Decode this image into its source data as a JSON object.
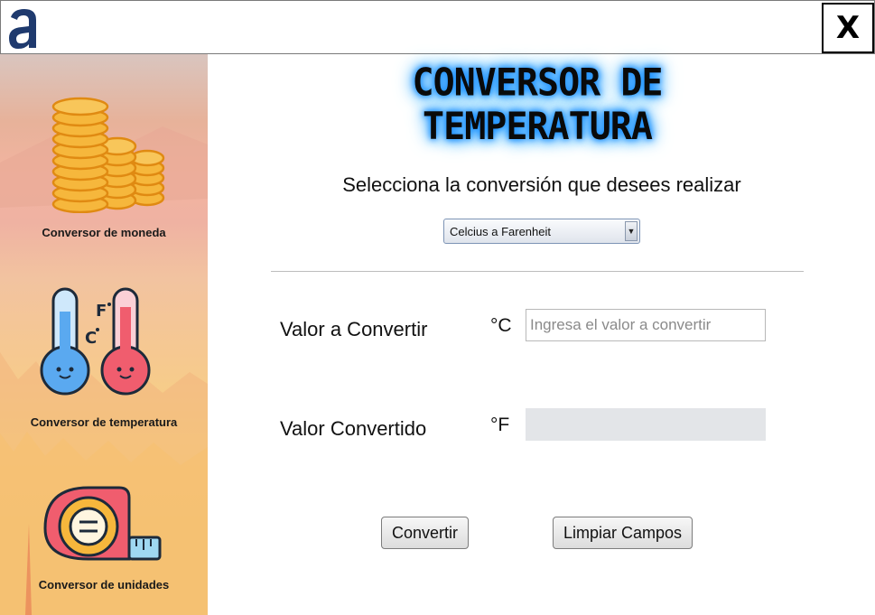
{
  "window": {
    "logo_icon": "a-logo-icon",
    "close_label": "X"
  },
  "sidebar": {
    "items": [
      {
        "label": "Conversor de moneda",
        "icon": "coins-icon"
      },
      {
        "label": "Conversor de temperatura",
        "icon": "thermometer-icon"
      },
      {
        "label": "Conversor de unidades",
        "icon": "measuring-tape-icon"
      }
    ]
  },
  "main": {
    "title_line1": "CONVERSOR DE",
    "title_line2": "TEMPERATURA",
    "subtitle": "Selecciona la conversión que desees realizar",
    "conversion_select": {
      "selected": "Celcius a Farenheit"
    },
    "input_row": {
      "label": "Valor a Convertir",
      "unit": "°C",
      "placeholder": "Ingresa el valor a convertir",
      "value": ""
    },
    "output_row": {
      "label": "Valor Convertido",
      "unit": "°F",
      "value": ""
    },
    "buttons": {
      "convert": "Convertir",
      "clear": "Limpiar Campos"
    }
  },
  "colors": {
    "accent_glow": "#1e90ff",
    "logo_blue": "#1f3a6e",
    "coin_gold": "#f6b73c",
    "thermo_blue": "#5aa9f0",
    "thermo_red": "#f05d6e"
  }
}
